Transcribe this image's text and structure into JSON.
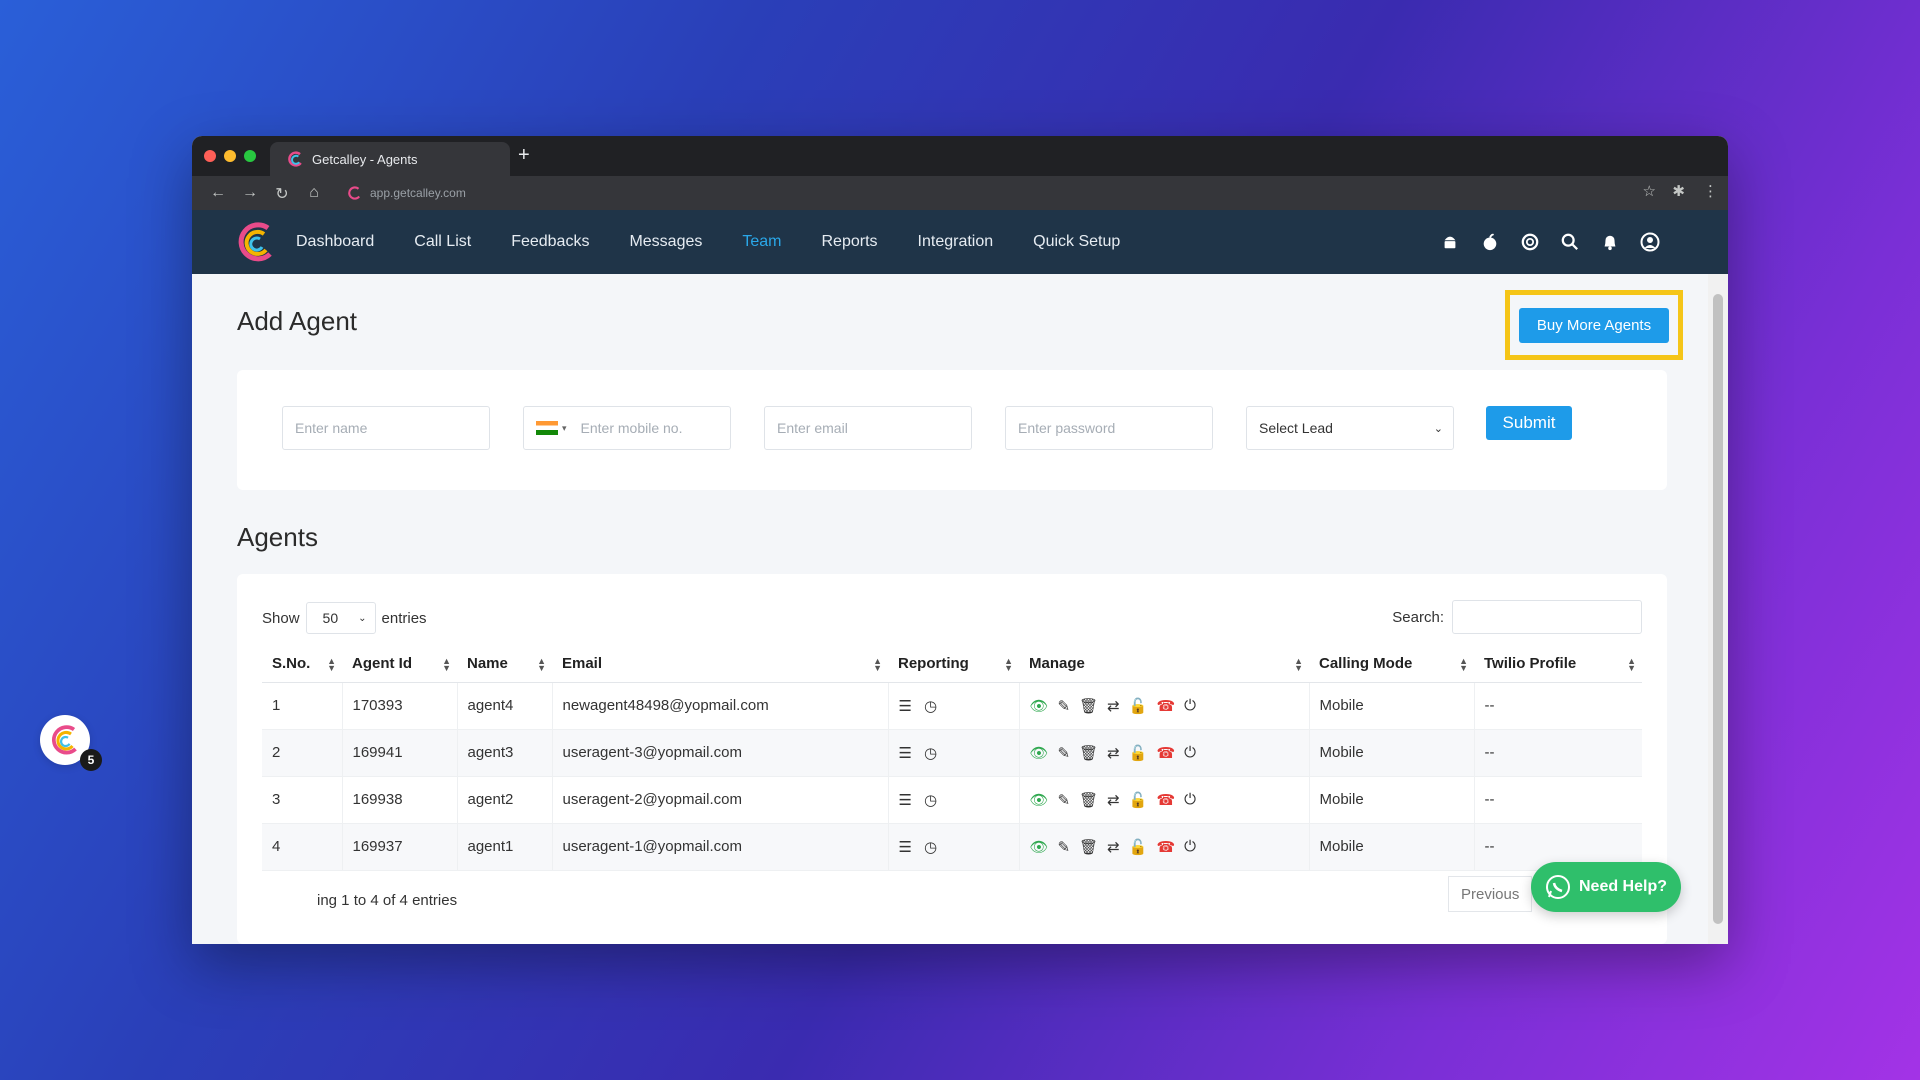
{
  "browser": {
    "tab_title": "Getcalley - Agents",
    "url": "app.getcalley.com"
  },
  "nav": {
    "items": [
      "Dashboard",
      "Call List",
      "Feedbacks",
      "Messages",
      "Team",
      "Reports",
      "Integration",
      "Quick Setup"
    ],
    "active": "Team",
    "icons": [
      "android-icon",
      "apple-icon",
      "support-icon",
      "search-icon",
      "bell-icon",
      "user-icon"
    ]
  },
  "add_agent": {
    "title": "Add Agent",
    "buy_button": "Buy More Agents",
    "name_placeholder": "Enter name",
    "mobile_placeholder": "Enter mobile no.",
    "email_placeholder": "Enter email",
    "password_placeholder": "Enter password",
    "lead_select": "Select Lead",
    "submit": "Submit"
  },
  "agents": {
    "title": "Agents",
    "show_label": "Show",
    "entries_value": "50",
    "entries_label": "entries",
    "search_label": "Search:",
    "columns": [
      "S.No.",
      "Agent Id",
      "Name",
      "Email",
      "Reporting",
      "Manage",
      "Calling Mode",
      "Twilio Profile"
    ],
    "rows": [
      {
        "sno": "1",
        "id": "170393",
        "name": "agent4",
        "email": "newagent48498@yopmail.com",
        "mode": "Mobile",
        "twilio": "--"
      },
      {
        "sno": "2",
        "id": "169941",
        "name": "agent3",
        "email": "useragent-3@yopmail.com",
        "mode": "Mobile",
        "twilio": "--"
      },
      {
        "sno": "3",
        "id": "169938",
        "name": "agent2",
        "email": "useragent-2@yopmail.com",
        "mode": "Mobile",
        "twilio": "--"
      },
      {
        "sno": "4",
        "id": "169937",
        "name": "agent1",
        "email": "useragent-1@yopmail.com",
        "mode": "Mobile",
        "twilio": "--"
      }
    ],
    "footer": "ing 1 to 4 of 4 entries",
    "previous": "Previous"
  },
  "widgets": {
    "badge_count": "5",
    "help": "Need Help?"
  },
  "colors": {
    "nav_bg": "#1f3448",
    "accent": "#1e9be9",
    "highlight": "#f5c518",
    "whatsapp": "#2fbf6b"
  }
}
